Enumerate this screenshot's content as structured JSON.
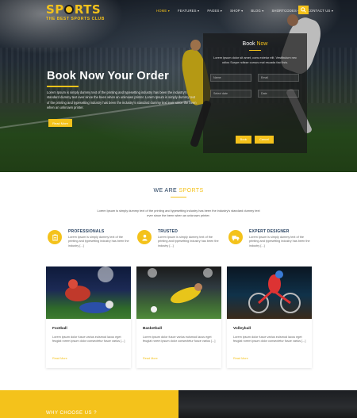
{
  "colors": {
    "accent": "#f4c21b",
    "heading": "#1f3a5a"
  },
  "header": {
    "logo_title": "SP",
    "logo_title_end": "RTS",
    "logo_sub": "THE BEST SPORTS CLUB",
    "nav": [
      {
        "label": "HOME ▾",
        "active": true
      },
      {
        "label": "FEATURES ▾"
      },
      {
        "label": "PAGES ▾"
      },
      {
        "label": "SHOP ▾"
      },
      {
        "label": "BLOG ▾"
      },
      {
        "label": "SHORTCODES ▾"
      },
      {
        "label": "CONTACT US ▾"
      }
    ],
    "search_icon": "search-icon"
  },
  "hero": {
    "heading": "Book Now Your Order",
    "text": "Lorem Ipsum is simply dummy text of the printing and typesetting industry has been the industry's standard dummy text ever since the been when an unknown printer. Lorem Ipsum is simply dummy text of the printing and typesetting industry has been the industry's standard dummy text ever since the been when an unknown printer.",
    "button": "Read More"
  },
  "booking": {
    "title": "Book",
    "title_accent": "Now",
    "desc": "Lorem ipsum dolor sit amet, cons ectetur elit. Vestibulum nec odios Suspe ndisse cursus mal esuada faci lisis.",
    "fields": [
      "Name",
      "Email",
      "Select date",
      "Date"
    ],
    "buttons": [
      "Book",
      "Cancel"
    ]
  },
  "about": {
    "title": "WE ARE",
    "title_accent": "SPORTS",
    "text": "Lorem Ipsum is simply dummy text of the printing and typesetting industry has been the industry's standard dummy text ever since the been when an unknown printer.",
    "features": [
      {
        "title": "PROFESSIONALS",
        "text": "Lorem Ipsum is simply dummy text of the printing and typesetting industry has been the industry [...]",
        "icon": "clipboard-icon"
      },
      {
        "title": "TRUSTED",
        "text": "Lorem Ipsum is simply dummy text of the printing and typesetting industry has been the industry [...]",
        "icon": "person-icon"
      },
      {
        "title": "EXPERT DESIGNER",
        "text": "Lorem Ipsum is simply dummy text of the printing and typesetting industry has been the industry [...]",
        "icon": "truck-icon"
      }
    ]
  },
  "cards": [
    {
      "title": "Football",
      "text": "Lorem ipsum dolor fusce varius euismod lacus eget feugiat rorem ipsum dolor consectetur fusce varius [...]",
      "link": "Read More"
    },
    {
      "title": "Basketball",
      "text": "Lorem ipsum dolor fusce varius euismod lacus eget feugiat rorem ipsum dolor consectetur fusce varius [...]",
      "link": "Read More"
    },
    {
      "title": "Volleyball",
      "text": "Lorem ipsum dolor fusce varius euismod lacus eget feugiat rorem ipsum dolor consectetur fusce varius [...]",
      "link": "Read More"
    }
  ],
  "why": {
    "title": "WHY CHOOSE US ?"
  }
}
